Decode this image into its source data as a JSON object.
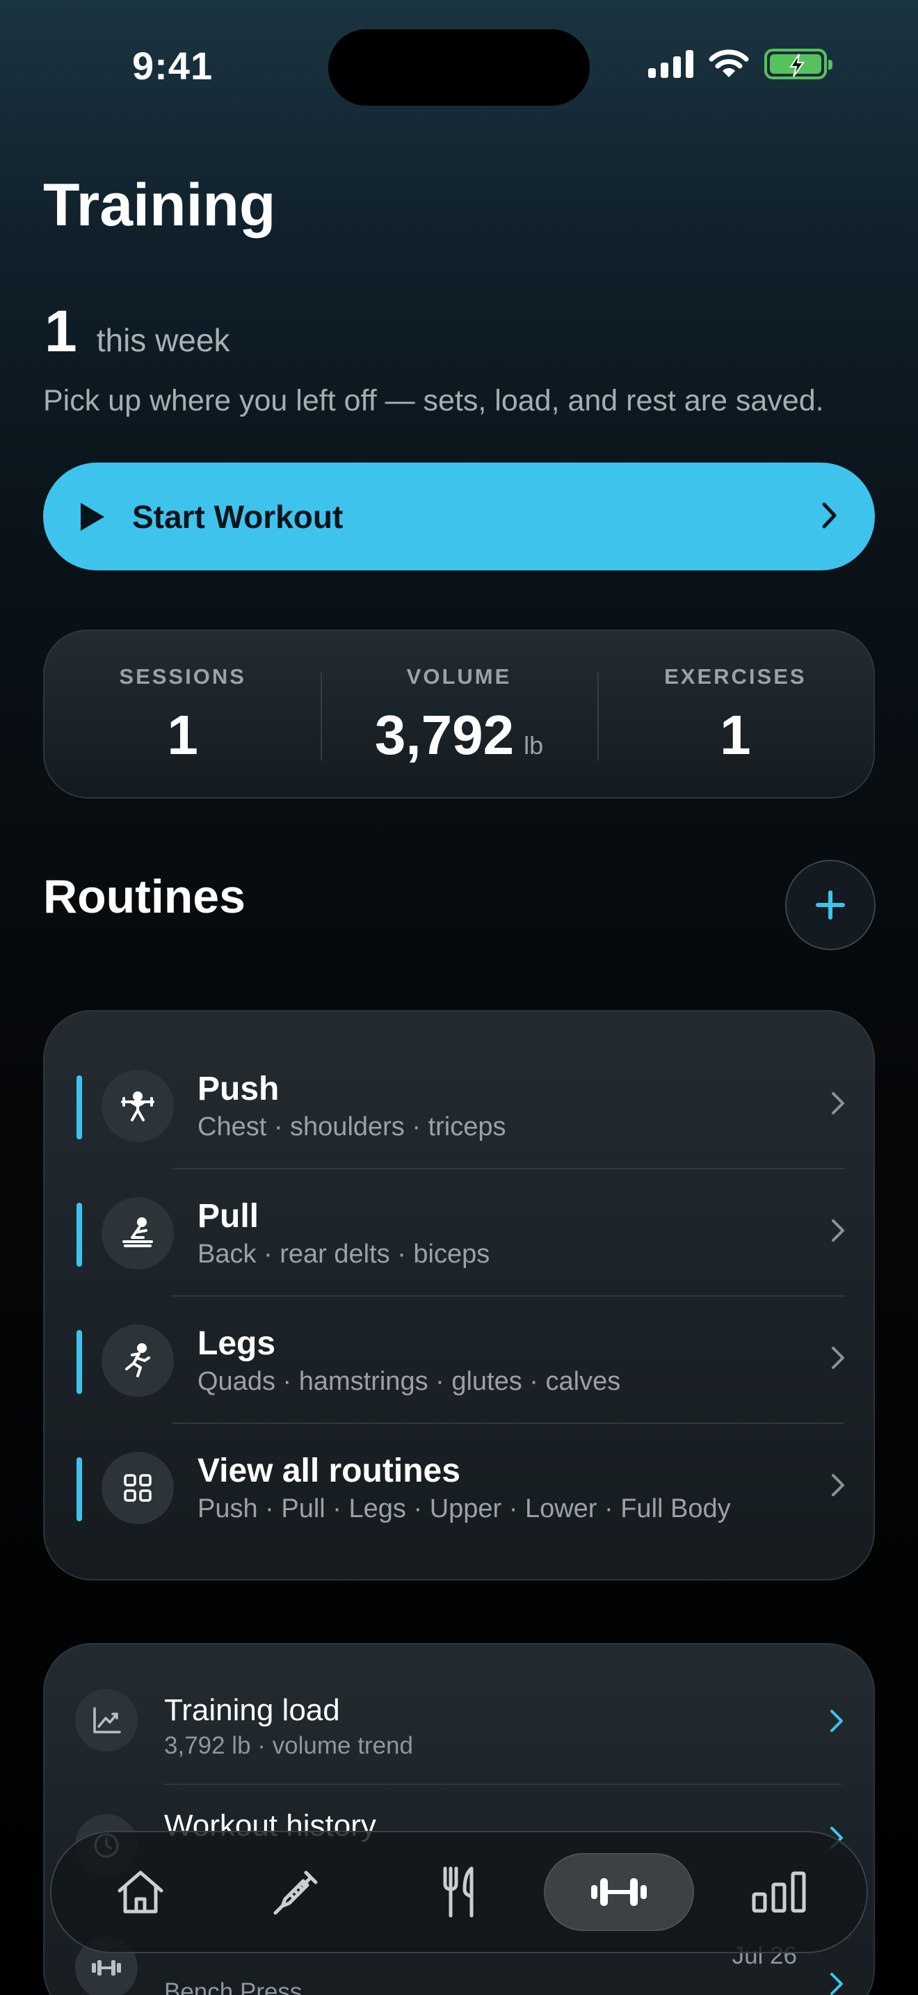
{
  "status_bar": {
    "time": "9:41"
  },
  "header": {
    "title": "Training"
  },
  "week": {
    "count": "1",
    "label": "this week",
    "subtitle": "Pick up where you left off — sets, load, and rest are saved."
  },
  "start_workout": {
    "label": "Start Workout"
  },
  "stats": {
    "sessions": {
      "label": "SESSIONS",
      "value": "1"
    },
    "volume": {
      "label": "VOLUME",
      "value": "3,792",
      "unit": "lb"
    },
    "exercises": {
      "label": "EXERCISES",
      "value": "1"
    }
  },
  "routines": {
    "title": "Routines",
    "items": [
      {
        "title": "Push",
        "subtitle": "Chest · shoulders · triceps",
        "icon": "weightlifter-icon"
      },
      {
        "title": "Pull",
        "subtitle": "Back · rear delts · biceps",
        "icon": "rowing-icon"
      },
      {
        "title": "Legs",
        "subtitle": "Quads · hamstrings · glutes · calves",
        "icon": "running-icon"
      },
      {
        "title": "View all routines",
        "subtitle": "Push · Pull · Legs · Upper · Lower · Full Body",
        "icon": "grid-icon"
      }
    ]
  },
  "insights": {
    "training_load": {
      "title": "Training load",
      "subtitle": "3,792 lb · volume trend"
    },
    "workout_history": {
      "title": "Workout history"
    },
    "recent": {
      "subtitle": "Bench Press",
      "date": "Jul 26"
    }
  },
  "tabs": [
    {
      "name": "home",
      "icon": "home-icon"
    },
    {
      "name": "injection",
      "icon": "syringe-icon"
    },
    {
      "name": "nutrition",
      "icon": "fork-knife-icon"
    },
    {
      "name": "training",
      "icon": "dumbbell-icon",
      "active": true
    },
    {
      "name": "stats",
      "icon": "bar-chart-icon"
    }
  ],
  "colors": {
    "accent": "#3ec4ec",
    "battery": "#57c25b",
    "background": "#000000"
  }
}
